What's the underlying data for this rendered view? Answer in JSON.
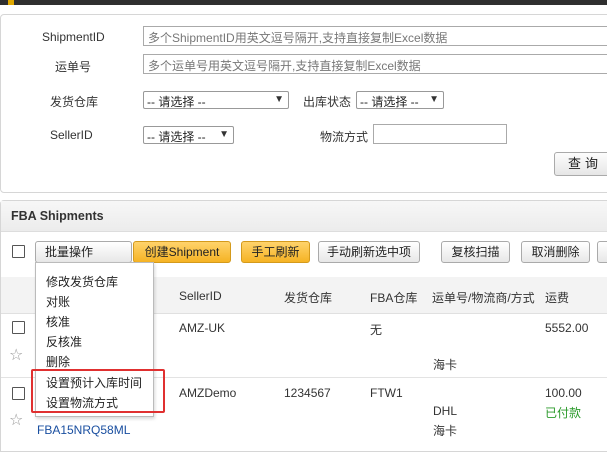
{
  "topbar": {
    "accent_color": "#e0a800"
  },
  "search": {
    "shipment_id_label": "ShipmentID",
    "shipment_id_placeholder": "多个ShipmentID用英文逗号隔开,支持直接复制Excel数据",
    "tracking_label": "运单号",
    "tracking_placeholder": "多个运单号用英文逗号隔开,支持直接复制Excel数据",
    "warehouse_label": "发货仓库",
    "warehouse_value": "-- 请选择 --",
    "outbound_status_label": "出库状态",
    "outbound_status_value": "-- 请选择 --",
    "seller_label": "SellerID",
    "seller_value": "-- 请选择 --",
    "logistics_label": "物流方式",
    "logistics_value": "",
    "query_label": "查询"
  },
  "fba": {
    "title": "FBA Shipments",
    "toolbar": {
      "batch": "批量操作",
      "create": "创建Shipment",
      "manual_refresh": "手工刷新",
      "refresh_selected": "手动刷新选中项",
      "recheck_scan": "复核扫描",
      "cancel_delete": "取消删除"
    },
    "columns": [
      "SellerID",
      "发货仓库",
      "FBA仓库",
      "运单号/物流商/方式",
      "运费"
    ],
    "rows": [
      {
        "seller": "AMZ-UK",
        "warehouse": "",
        "fba_warehouse": "无",
        "carrier": "",
        "method": "海卡",
        "freight": "5552.00",
        "status": ""
      },
      {
        "seller": "AMZDemo",
        "warehouse": "1234567",
        "fba_warehouse": "FTW1",
        "carrier": "DHL",
        "method": "海卡",
        "freight": "100.00",
        "status": "已付款",
        "shipment_id": "FBA15NRQ58ML"
      }
    ],
    "batch_menu": [
      "修改发货仓库",
      "对账",
      "核准",
      "反核准",
      "删除",
      "设置预计入库时间",
      "设置物流方式"
    ]
  }
}
